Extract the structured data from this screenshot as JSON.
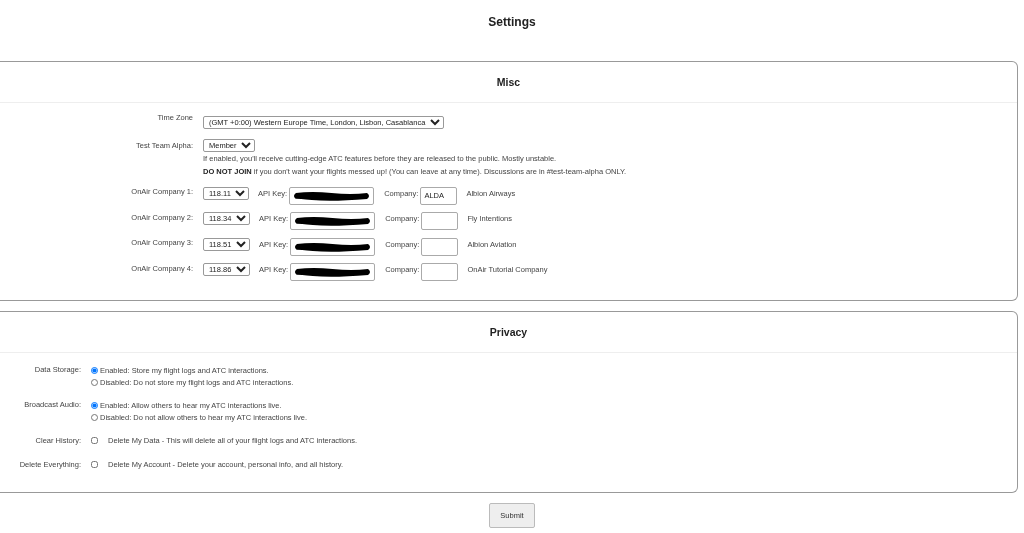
{
  "title": "Settings",
  "misc": {
    "title": "Misc",
    "time_zone": {
      "label": "Time Zone",
      "value": "(GMT +0:00) Western Europe Time, London, Lisbon, Casablanca"
    },
    "test_team": {
      "label": "Test Team Alpha:",
      "value": "Member",
      "note": "If enabled, you'll receive cutting-edge ATC features before they are released to the public. Mostly unstable.",
      "warning": "**DO NOT JOIN** if you don't want your flights messed up! (You can leave at any time). Discussions are in #test-team-alpha ONLY."
    },
    "companies": [
      {
        "label": "OnAir Company 1:",
        "frequency": "118.11",
        "api_key_label": "API Key:",
        "api_key_redacted": true,
        "company_label": "Company:",
        "company_value": "ALDA",
        "company_name": "Albion Airways"
      },
      {
        "label": "OnAir Company 2:",
        "frequency": "118.34",
        "api_key_label": "API Key:",
        "api_key_redacted": true,
        "company_label": "Company:",
        "company_name": "Fly Intentions"
      },
      {
        "label": "OnAir Company 3:",
        "frequency": "118.51",
        "api_key_label": "API Key:",
        "api_key_redacted": true,
        "company_label": "Company:",
        "company_name": "Albion Aviation"
      },
      {
        "label": "OnAir Company 4:",
        "frequency": "118.86",
        "api_key_label": "API Key:",
        "api_key_redacted": true,
        "company_label": "Company:",
        "company_name": "OnAir Tutorial Company"
      }
    ]
  },
  "privacy": {
    "title": "Privacy",
    "options": [
      {
        "kind": "radio",
        "label": "Data Storage:",
        "choices": [
          {
            "text": "Enabled: Store my flight logs and ATC interactions.",
            "selected": true
          },
          {
            "text": "Disabled: Do not store my flight logs and ATC interactions.",
            "selected": false
          }
        ]
      },
      {
        "kind": "radio",
        "label": "Broadcast Audio:",
        "choices": [
          {
            "text": "Enabled: Allow others to hear my ATC interactions live.",
            "selected": true
          },
          {
            "text": "Disabled: Do not allow others to hear my ATC interactions live.",
            "selected": false
          }
        ]
      },
      {
        "kind": "checkbox",
        "label": "Clear History:",
        "text": "Delete My Data - This will delete all of your flight logs and ATC interactions.",
        "checked": false
      },
      {
        "kind": "checkbox",
        "label": "Delete Everything:",
        "text": "Delete My Account - Delete your account, personal info, and all history.",
        "checked": false
      }
    ]
  },
  "submit": "Submit"
}
